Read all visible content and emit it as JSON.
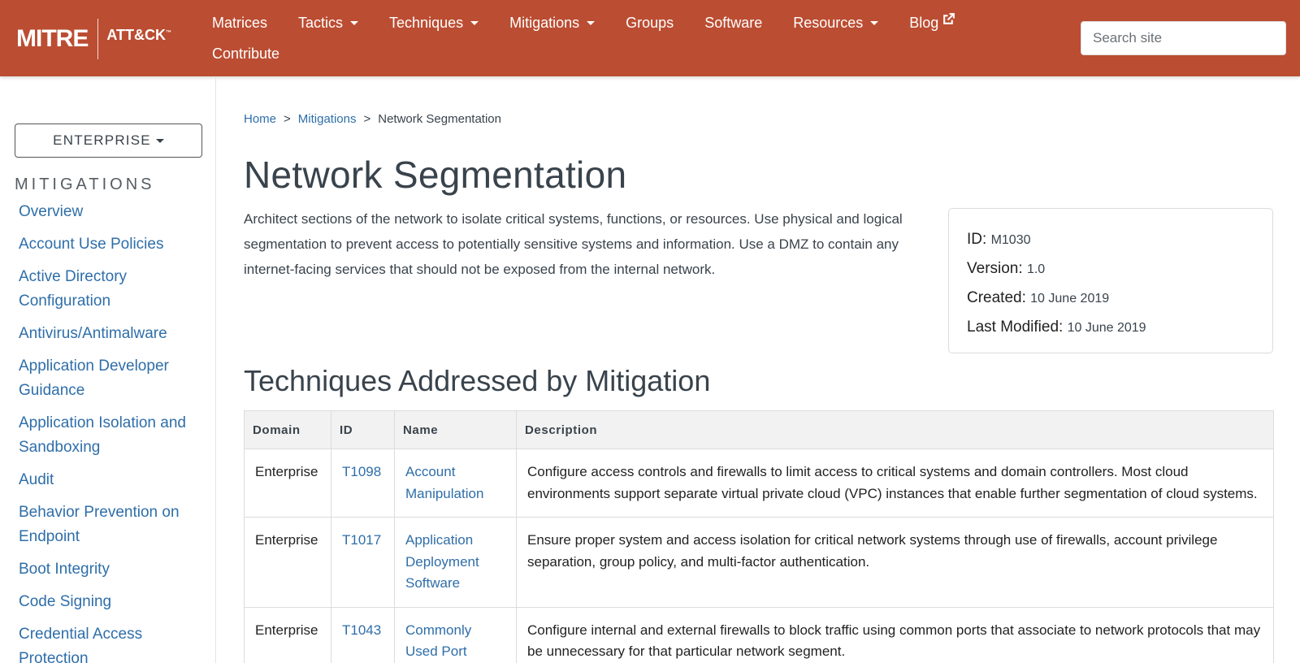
{
  "navbar": {
    "logo_mitre": "MITRE",
    "logo_attack": "ATT&CK",
    "logo_tm": "™",
    "items": [
      {
        "label": "Matrices",
        "dropdown": false
      },
      {
        "label": "Tactics",
        "dropdown": true
      },
      {
        "label": "Techniques",
        "dropdown": true
      },
      {
        "label": "Mitigations",
        "dropdown": true
      },
      {
        "label": "Groups",
        "dropdown": false
      },
      {
        "label": "Software",
        "dropdown": false
      },
      {
        "label": "Resources",
        "dropdown": true
      },
      {
        "label": "Blog",
        "dropdown": false,
        "external": true
      },
      {
        "label": "Contribute",
        "dropdown": false
      }
    ],
    "search_placeholder": "Search site",
    "bg_color": "#bb4d32"
  },
  "sidebar": {
    "domain_button": "ENTERPRISE",
    "heading": "MITIGATIONS",
    "items": [
      "Overview",
      "Account Use Policies",
      "Active Directory Configuration",
      "Antivirus/Antimalware",
      "Application Developer Guidance",
      "Application Isolation and Sandboxing",
      "Audit",
      "Behavior Prevention on Endpoint",
      "Boot Integrity",
      "Code Signing",
      "Credential Access Protection"
    ]
  },
  "breadcrumb": {
    "home": "Home",
    "sep": ">",
    "mitigations": "Mitigations",
    "current": "Network Segmentation"
  },
  "page": {
    "title": "Network Segmentation",
    "description": "Architect sections of the network to isolate critical systems, functions, or resources. Use physical and logical segmentation to prevent access to potentially sensitive systems and information. Use a DMZ to contain any internet-facing services that should not be exposed from the internal network."
  },
  "card": {
    "id_label": "ID:",
    "id_value": "M1030",
    "version_label": "Version:",
    "version_value": "1.0",
    "created_label": "Created:",
    "created_value": "10 June 2019",
    "modified_label": "Last Modified:",
    "modified_value": "10 June 2019"
  },
  "techniques": {
    "title": "Techniques Addressed by Mitigation",
    "headers": {
      "domain": "Domain",
      "id": "ID",
      "name": "Name",
      "description": "Description"
    },
    "rows": [
      {
        "domain": "Enterprise",
        "id": "T1098",
        "name": "Account Manipulation",
        "description": "Configure access controls and firewalls to limit access to critical systems and domain controllers. Most cloud environments support separate virtual private cloud (VPC) instances that enable further segmentation of cloud systems."
      },
      {
        "domain": "Enterprise",
        "id": "T1017",
        "name": "Application Deployment Software",
        "description": "Ensure proper system and access isolation for critical network systems through use of firewalls, account privilege separation, group policy, and multi-factor authentication."
      },
      {
        "domain": "Enterprise",
        "id": "T1043",
        "name": "Commonly Used Port",
        "description": "Configure internal and external firewalls to block traffic using common ports that associate to network protocols that may be unnecessary for that particular network segment."
      }
    ]
  }
}
